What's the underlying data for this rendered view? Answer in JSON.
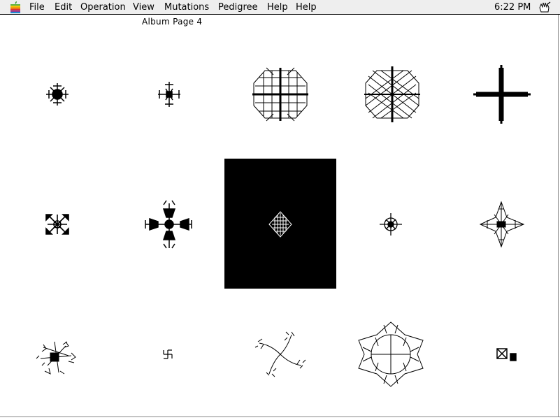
{
  "menubar": {
    "items": [
      "File",
      "Edit",
      "Operation",
      "View",
      "Mutations",
      "Pedigree",
      "Help",
      "Help"
    ],
    "clock": "6:22 PM",
    "apple_icon": "apple-icon",
    "app_icon": "hand-icon"
  },
  "album": {
    "title": "Album Page 4",
    "selected_cell": "row2-col3",
    "biomorphs": [
      {
        "name": "biomorph-r1c1"
      },
      {
        "name": "biomorph-r1c2"
      },
      {
        "name": "biomorph-r1c3"
      },
      {
        "name": "biomorph-r1c4"
      },
      {
        "name": "biomorph-r1c5"
      },
      {
        "name": "biomorph-r2c1"
      },
      {
        "name": "biomorph-r2c2"
      },
      {
        "name": "biomorph-r2c3"
      },
      {
        "name": "biomorph-r2c4"
      },
      {
        "name": "biomorph-r2c5"
      },
      {
        "name": "biomorph-r3c1"
      },
      {
        "name": "biomorph-r3c2"
      },
      {
        "name": "biomorph-r3c3"
      },
      {
        "name": "biomorph-r3c4"
      },
      {
        "name": "biomorph-r3c5"
      }
    ]
  }
}
